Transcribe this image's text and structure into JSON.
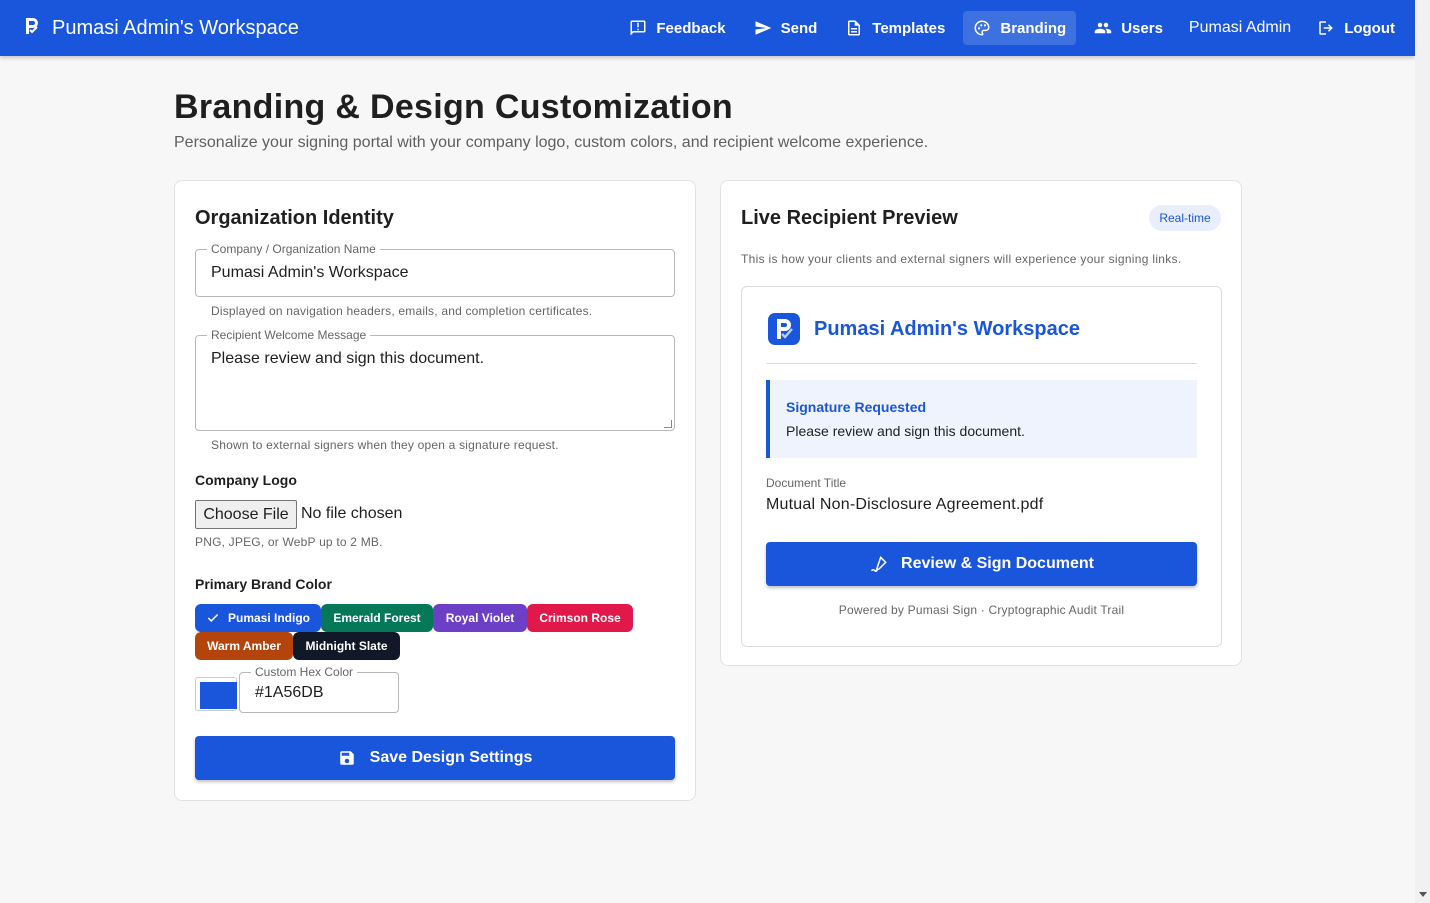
{
  "appbar": {
    "title": "Pumasi Admin's Workspace",
    "nav": {
      "feedback": "Feedback",
      "send": "Send",
      "templates": "Templates",
      "branding": "Branding",
      "users": "Users",
      "user_name": "Pumasi Admin",
      "logout": "Logout"
    },
    "active_item": "branding"
  },
  "page": {
    "title": "Branding & Design Customization",
    "subtitle": "Personalize your signing portal with your company logo, custom colors, and recipient welcome experience."
  },
  "identity": {
    "title": "Organization Identity",
    "company_name": {
      "label": "Company / Organization Name",
      "value": "Pumasi Admin's Workspace",
      "helper": "Displayed on navigation headers, emails, and completion certificates."
    },
    "welcome_message": {
      "label": "Recipient Welcome Message",
      "value": "Please review and sign this document.",
      "helper": "Shown to external signers when they open a signature request."
    },
    "logo": {
      "label": "Company Logo",
      "button": "Choose File",
      "status": "No file chosen",
      "helper": "PNG, JPEG, or WebP up to 2 MB."
    },
    "brand_color": {
      "label": "Primary Brand Color",
      "presets": [
        {
          "name": "Pumasi Indigo",
          "color": "#1a56db",
          "selected": true
        },
        {
          "name": "Emerald Forest",
          "color": "#047857",
          "selected": false
        },
        {
          "name": "Royal Violet",
          "color": "#6d3fc6",
          "selected": false
        },
        {
          "name": "Crimson Rose",
          "color": "#e0194a",
          "selected": false
        },
        {
          "name": "Warm Amber",
          "color": "#b4440c",
          "selected": false
        },
        {
          "name": "Midnight Slate",
          "color": "#111827",
          "selected": false
        }
      ],
      "custom_hex": {
        "label": "Custom Hex Color",
        "value": "#1A56DB"
      },
      "swatch_color": "#1a56db"
    },
    "save_button": "Save Design Settings"
  },
  "preview": {
    "title": "Live Recipient Preview",
    "badge": "Real-time",
    "description": "This is how your clients and external signers will experience your signing links.",
    "org_name": "Pumasi Admin's Workspace",
    "alert_title": "Signature Requested",
    "alert_message": "Please review and sign this document.",
    "doc_label": "Document Title",
    "doc_title": "Mutual Non-Disclosure Agreement.pdf",
    "sign_button": "Review & Sign Document",
    "footer": "Powered by Pumasi Sign · Cryptographic Audit Trail"
  },
  "colors": {
    "primary": "#1a56db",
    "background": "#f7f7f8"
  }
}
